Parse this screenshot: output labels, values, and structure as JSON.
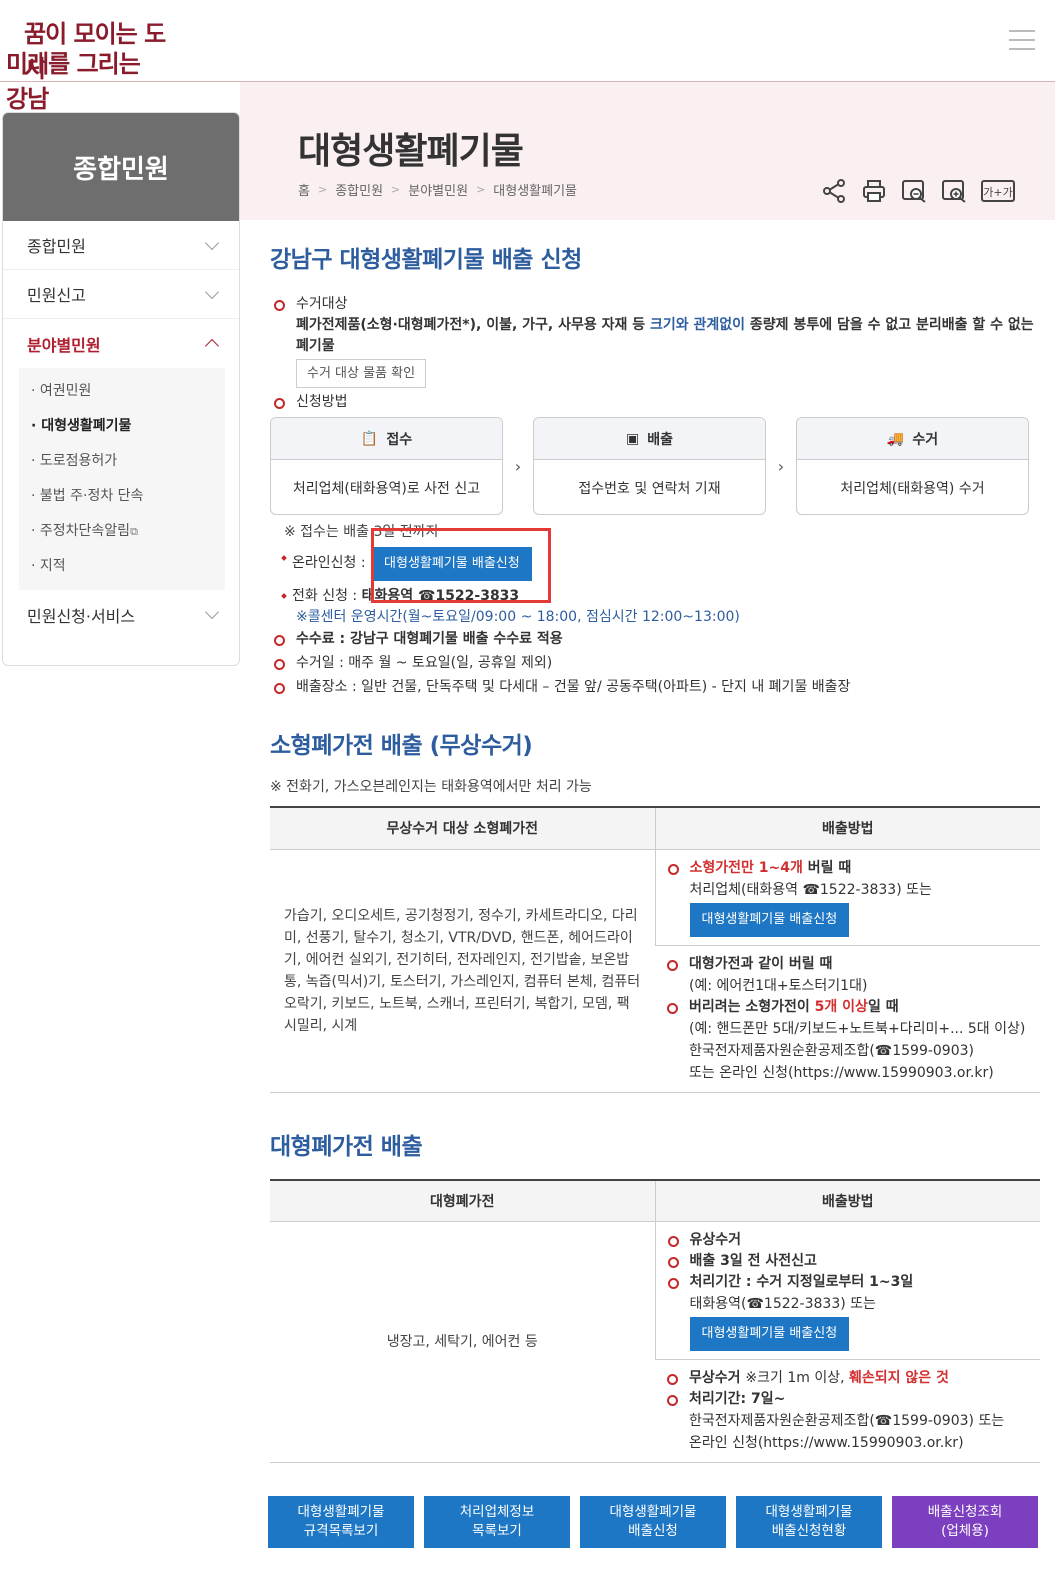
{
  "header": {
    "logo_line1": "꿈이 모이는 도시",
    "logo_line2": "미래를 그리는 강남"
  },
  "sidebar": {
    "title": "종합민원",
    "items": [
      {
        "label": "종합민원"
      },
      {
        "label": "민원신고"
      },
      {
        "label": "분야별민원"
      },
      {
        "label": "민원신청·서비스"
      }
    ],
    "subitems": [
      {
        "label": "· 여권민원"
      },
      {
        "label": "· 대형생활폐기물"
      },
      {
        "label": "· 도로점용허가"
      },
      {
        "label": "· 불법 주·정차 단속"
      },
      {
        "label": "· 주정차단속알림"
      },
      {
        "label": "· 지적"
      }
    ]
  },
  "page": {
    "title": "대형생활폐기물",
    "breadcrumb": [
      "홈",
      "종합민원",
      "분야별민원",
      "대형생활폐기물"
    ],
    "tools": [
      "share-icon",
      "print-icon",
      "zoom-out-icon",
      "zoom-in-icon",
      "font-size-icon"
    ],
    "tool_font_label": "가+가"
  },
  "section1": {
    "title": "강남구 대형생활폐기물 배출 신청",
    "target_label": "수거대상",
    "target_text_a": "폐가전제품(소형·대형폐가전*), 이불, 가구, 사무용 자재 등 ",
    "target_text_blue": "크기와 관계없이",
    "target_text_b": " 종량제 봉투에 담을 수 없고 분리배출 할 수 없는 폐기물",
    "target_btn": "수거 대상 물품 확인",
    "method_label": "신청방법",
    "steps": [
      {
        "title": "접수",
        "body": "처리업체(태화용역)로 사전 신고"
      },
      {
        "title": "배출",
        "body": "접수번호 및 연락처 기재"
      },
      {
        "title": "수거",
        "body": "처리업체(태화용역) 수거"
      }
    ],
    "note_deadline": "※ 접수는 배출 3일 전까지",
    "online_label": "온라인신청 :",
    "online_btn": "대형생활폐기물 배출신청",
    "phone_label": "전화 신청 : ",
    "phone_value": "태화용역 ☎1522-3833",
    "callcenter": "※콜센터 운영시간(월~토요일/09:00 ~ 18:00, 점심시간 12:00~13:00)",
    "fee": "수수료 : 강남구 대형폐기물 배출 수수료 적용",
    "collect_day": "수거일 : 매주 월 ~ 토요일(일, 공휴일 제외)",
    "place": "배출장소 : 일반 건물, 단독주택 및 다세대 – 건물 앞/ 공동주택(아파트) - 단지 내 폐기물 배출장"
  },
  "section2": {
    "title": "소형폐가전 배출 (무상수거)",
    "note": "※ 전화기, 가스오븐레인지는 태화용역에서만 처리 가능",
    "col1": "무상수거 대상 소형폐가전",
    "col2": "배출방법",
    "items_text": "가습기, 오디오세트, 공기청정기, 정수기, 카세트라디오, 다리미, 선풍기, 탈수기, 청소기, VTR/DVD, 핸드폰, 헤어드라이기, 에어컨 실외기, 전기히터, 전자레인지, 전기밥솥, 보온밥통, 녹즙(믹서)기, 토스터기, 가스레인지, 컴퓨터 본체, 컴퓨터 오락기, 키보드, 노트북, 스캐너, 프린터기, 복합기, 모뎀, 팩시밀리, 시계",
    "m1_red": "소형가전만 1~4개",
    "m1_rest": " 버릴 때",
    "m1_line2": "처리업체(태화용역 ☎1522-3833) 또는",
    "m1_btn": "대형생활폐기물 배출신청",
    "m2_title": "대형가전과 같이 버릴 때",
    "m2_line2": "(예: 에어컨1대+토스터기1대)",
    "m3_a": "버리려는 소형가전이 ",
    "m3_red": "5개 이상",
    "m3_b": "일 때",
    "m3_line2": "(예: 핸드폰만 5대/키보드+노트북+다리미+... 5대 이상)",
    "m3_line3": "한국전자제품자원순환공제조합(☎1599-0903)",
    "m3_line4": "또는 온라인 신청(https://www.15990903.or.kr)"
  },
  "section3": {
    "title": "대형폐가전 배출",
    "col1": "대형폐가전",
    "col2": "배출방법",
    "items_text": "냉장고, 세탁기, 에어컨 등",
    "p1": "유상수거",
    "p2": "배출 3일 전 사전신고",
    "p3": "처리기간 : 수거 지정일로부터 1~3일",
    "p3_line2": "태화용역(☎1522-3833) 또는",
    "p_btn": "대형생활폐기물 배출신청",
    "f1_a": "무상수거 ",
    "f1_b": "※크기 1m 이상, ",
    "f1_red": "훼손되지 않은 것",
    "f2": "처리기간: 7일~",
    "f2_line2": "한국전자제품자원순환공제조합(☎1599-0903) 또는",
    "f2_line3": "온라인 신청(https://www.15990903.or.kr)"
  },
  "bottom_buttons": [
    {
      "l1": "대형생활폐기물",
      "l2": "규격목록보기"
    },
    {
      "l1": "처리업체정보",
      "l2": "목록보기"
    },
    {
      "l1": "대형생활폐기물",
      "l2": "배출신청"
    },
    {
      "l1": "대형생활폐기물",
      "l2": "배출신청현황"
    },
    {
      "l1": "배출신청조회",
      "l2": "(업체용)"
    }
  ],
  "colors": {
    "accent_red": "#c62828",
    "heading_blue": "#2d5d9f",
    "button_blue": "#1e77c4",
    "button_purple": "#7b3fbf"
  }
}
